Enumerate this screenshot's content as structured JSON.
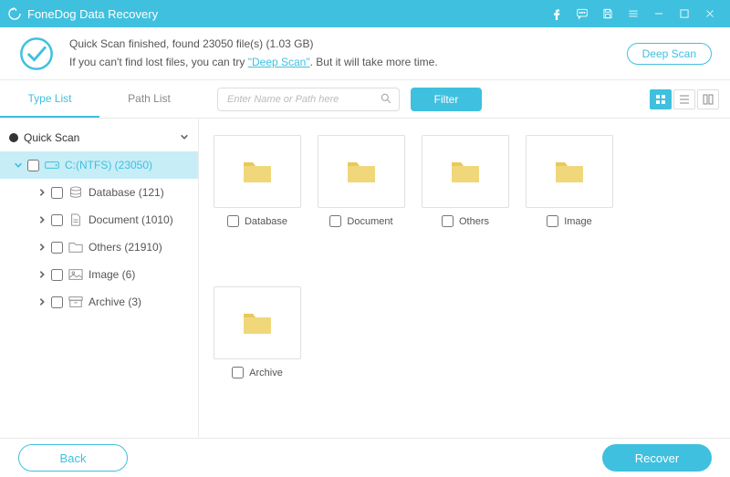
{
  "app": {
    "title": "FoneDog Data Recovery"
  },
  "info": {
    "line1": "Quick Scan finished, found 23050 file(s) (1.03 GB)",
    "line2_pre": "If you can't find lost files, you can try ",
    "line2_link": "\"Deep Scan\"",
    "line2_post": ". But it will take more time.",
    "deep_scan_btn": "Deep Scan"
  },
  "tabs": {
    "type": "Type List",
    "path": "Path List"
  },
  "search": {
    "placeholder": "Enter Name or Path here"
  },
  "filter_label": "Filter",
  "tree": {
    "root": "Quick Scan",
    "drive": "C:(NTFS) (23050)",
    "items": [
      {
        "label": "Database (121)"
      },
      {
        "label": "Document (1010)"
      },
      {
        "label": "Others (21910)"
      },
      {
        "label": "Image (6)"
      },
      {
        "label": "Archive (3)"
      }
    ]
  },
  "folders": [
    {
      "label": "Database"
    },
    {
      "label": "Document"
    },
    {
      "label": "Others"
    },
    {
      "label": "Image"
    },
    {
      "label": "Archive"
    }
  ],
  "footer": {
    "back": "Back",
    "recover": "Recover"
  }
}
